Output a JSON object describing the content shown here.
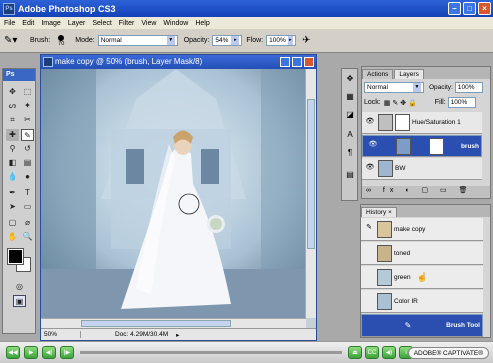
{
  "app": {
    "title": "Adobe Photoshop CS3"
  },
  "menu": [
    "File",
    "Edit",
    "Image",
    "Layer",
    "Select",
    "Filter",
    "View",
    "Window",
    "Help"
  ],
  "options": {
    "brush_label": "Brush:",
    "brush_size": "70",
    "mode_label": "Mode:",
    "mode_value": "Normal",
    "opacity_label": "Opacity:",
    "opacity_value": "54%",
    "flow_label": "Flow:",
    "flow_value": "100%"
  },
  "toolbox": {
    "header": "Ps"
  },
  "document": {
    "title": "make copy @ 50% (brush, Layer Mask/8)",
    "zoom": "50%",
    "doc_info": "Doc: 4.29M/30.4M"
  },
  "layers": {
    "tab_actions": "Actions",
    "tab_layers": "Layers",
    "blend_mode": "Normal",
    "opacity_label": "Opacity:",
    "opacity_value": "100%",
    "lock_label": "Lock:",
    "fill_label": "Fill:",
    "fill_value": "100%",
    "rows": [
      {
        "name": "Hue/Saturation 1"
      },
      {
        "name": "brush"
      },
      {
        "name": "BW"
      }
    ]
  },
  "history": {
    "tab": "History",
    "rows": [
      {
        "name": "make copy"
      },
      {
        "name": "toned"
      },
      {
        "name": "green"
      },
      {
        "name": "Color IR"
      },
      {
        "name": "Brush Tool"
      }
    ]
  },
  "captivate": {
    "brand": "ADOBE® CAPTIVATE®"
  }
}
